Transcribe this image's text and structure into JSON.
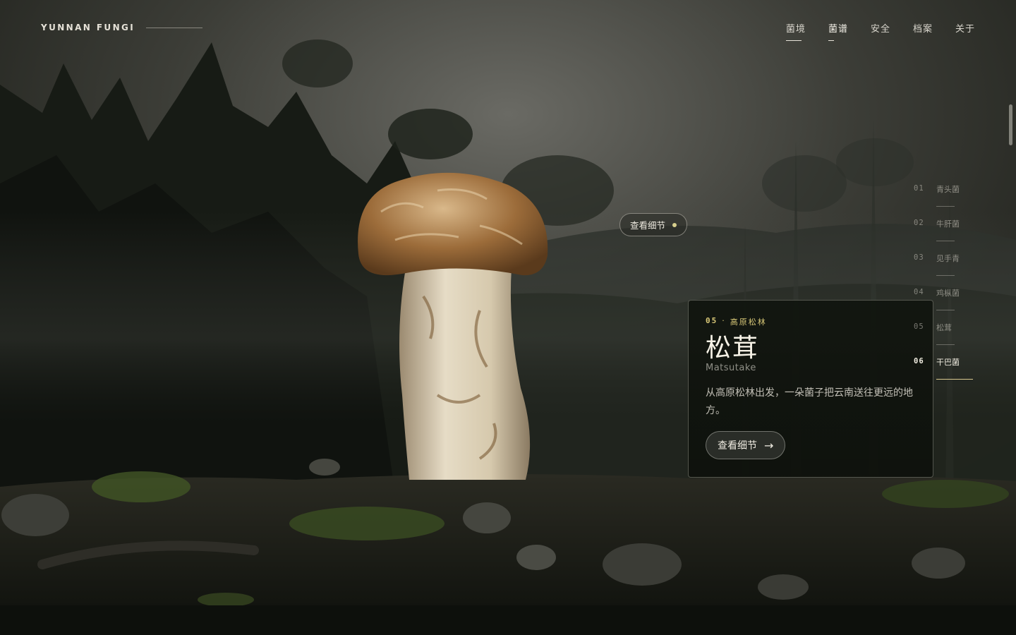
{
  "brand": {
    "name": "YUNNAN FUNGI"
  },
  "nav": {
    "items": [
      {
        "label": "菌境"
      },
      {
        "label": "菌谱"
      },
      {
        "label": "安全"
      },
      {
        "label": "档案"
      },
      {
        "label": "关于"
      }
    ]
  },
  "hotspot": {
    "label": "查看细节"
  },
  "card": {
    "number": "05",
    "separator": "·",
    "habitat": "高原松林",
    "title": "松茸",
    "subtitle": "Matsutake",
    "description": "从高原松林出发，一朵菌子把云南送往更远的地方。",
    "button_label": "查看细节",
    "button_icon": "arrow-right-icon"
  },
  "index": {
    "items": [
      {
        "num": "01",
        "label": "青头菌"
      },
      {
        "num": "02",
        "label": "牛肝菌"
      },
      {
        "num": "03",
        "label": "见手青"
      },
      {
        "num": "04",
        "label": "鸡枞菌"
      },
      {
        "num": "05",
        "label": "松茸"
      },
      {
        "num": "06",
        "label": "干巴菌"
      }
    ],
    "active": "06"
  },
  "colors": {
    "accent": "#d8c877",
    "background": "#0f100d",
    "text": "#e8e4da"
  }
}
